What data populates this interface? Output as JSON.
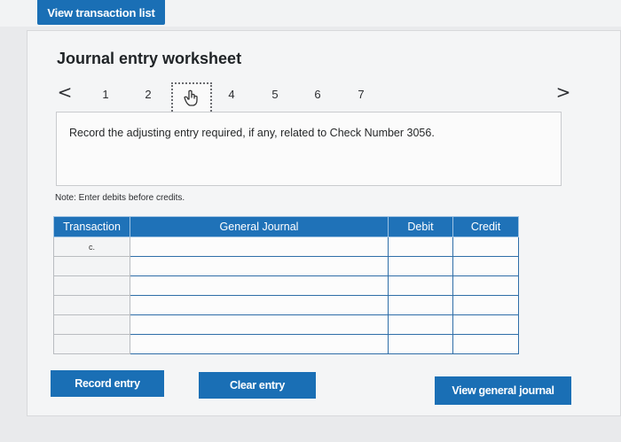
{
  "header": {
    "view_transaction_list": "View transaction list"
  },
  "worksheet": {
    "title": "Journal entry worksheet",
    "nav": {
      "prev": "<",
      "next": ">",
      "pages": [
        "1",
        "2",
        "3",
        "4",
        "5",
        "6",
        "7"
      ],
      "current_page": 3
    },
    "prompt": "Record the adjusting entry required, if any, related to Check Number 3056.",
    "note": "Note: Enter debits before credits."
  },
  "table": {
    "headers": [
      "Transaction",
      "General Journal",
      "Debit",
      "Credit"
    ],
    "rows": [
      {
        "transaction": "c.",
        "account": "",
        "debit": "",
        "credit": ""
      },
      {
        "transaction": "",
        "account": "",
        "debit": "",
        "credit": ""
      },
      {
        "transaction": "",
        "account": "",
        "debit": "",
        "credit": ""
      },
      {
        "transaction": "",
        "account": "",
        "debit": "",
        "credit": ""
      },
      {
        "transaction": "",
        "account": "",
        "debit": "",
        "credit": ""
      },
      {
        "transaction": "",
        "account": "",
        "debit": "",
        "credit": ""
      }
    ]
  },
  "buttons": {
    "record_entry": "Record entry",
    "clear_entry": "Clear entry",
    "view_general_journal": "View general journal"
  },
  "colors": {
    "accent": "#1a6fb5",
    "header_bg": "#1f72b8"
  }
}
